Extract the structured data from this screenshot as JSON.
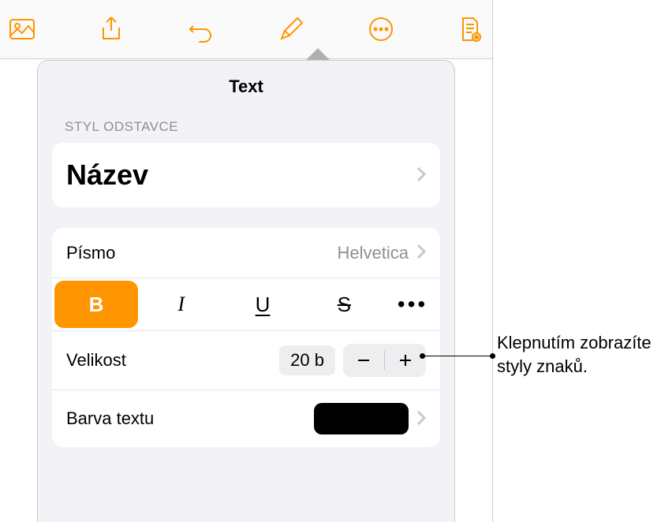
{
  "toolbar": {
    "icons": [
      "photo",
      "share",
      "undo",
      "brush",
      "more",
      "document"
    ]
  },
  "panel": {
    "title": "Text",
    "paragraph_style_label": "STYL ODSTAVCE",
    "paragraph_style_value": "Název",
    "font_label": "Písmo",
    "font_value": "Helvetica",
    "format": {
      "bold": "B",
      "italic": "I",
      "underline": "U",
      "strike": "S",
      "more": "•••",
      "bold_active": true
    },
    "size_label": "Velikost",
    "size_value": "20 b",
    "color_label": "Barva textu",
    "color_value": "#000000"
  },
  "callout": {
    "text": "Klepnutím zobrazíte styly znaků."
  }
}
